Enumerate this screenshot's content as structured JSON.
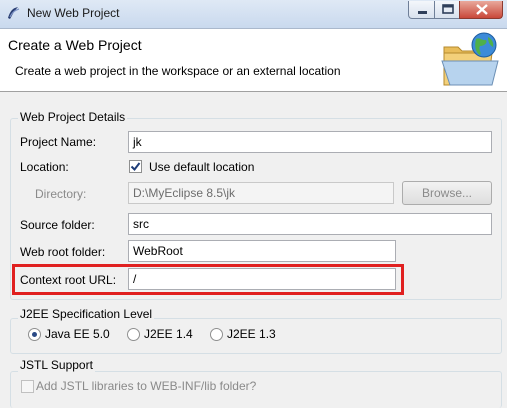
{
  "window": {
    "title": "New Web Project"
  },
  "banner": {
    "title": "Create a Web Project",
    "description": "Create a web project in the workspace or an external location"
  },
  "details": {
    "group_title": "Web Project Details",
    "project_name_label": "Project Name:",
    "project_name_value": "jk",
    "location_label": "Location:",
    "use_default_label": "Use default location",
    "use_default_checked": true,
    "directory_label": "Directory:",
    "directory_value": "D:\\MyEclipse 8.5\\jk",
    "browse_label": "Browse...",
    "source_folder_label": "Source folder:",
    "source_folder_value": "src",
    "web_root_label": "Web root folder:",
    "web_root_value": "WebRoot",
    "context_root_label": "Context root URL:",
    "context_root_value": "/"
  },
  "j2ee": {
    "group_title": "J2EE Specification Level",
    "options": [
      "Java EE 5.0",
      "J2EE 1.4",
      "J2EE 1.3"
    ],
    "selected": "Java EE 5.0"
  },
  "jstl": {
    "group_title": "JSTL Support",
    "checkbox_label": "Add JSTL libraries to WEB-INF/lib folder?",
    "checked": false
  },
  "colors": {
    "highlight": "#e02020",
    "accent": "#2a4a86"
  }
}
